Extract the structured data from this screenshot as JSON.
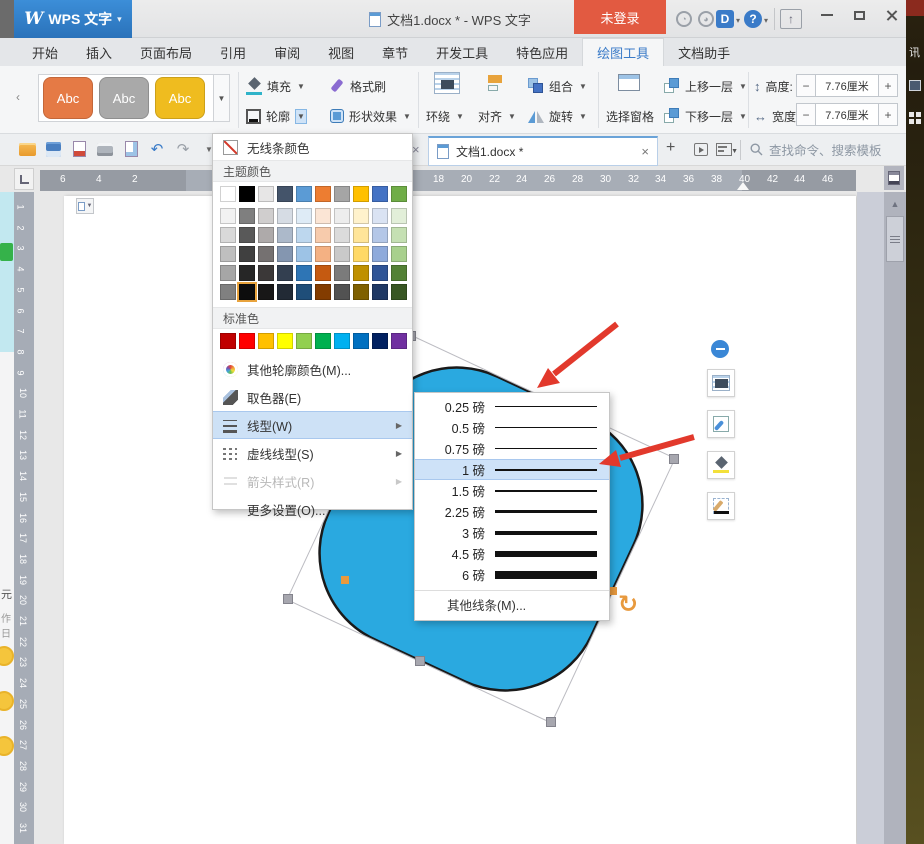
{
  "glyphs": {
    "dropdown": "▼",
    "submenu_arrow": "▶",
    "close": "×",
    "plus": "+",
    "minus": "−",
    "undo": "↶",
    "redo": "↷",
    "rotate": "↻",
    "scroll_up": "▲",
    "collapse_left": "‹",
    "app_dropdown": "▾",
    "gallery_more": "▼"
  },
  "title_bar": {
    "logo_letter": "W",
    "app_name": "WPS 文字",
    "doc_title": "文档1.docx * - WPS 文字",
    "login": "未登录",
    "d_badge": "D",
    "help": "?",
    "skin_arrow": "↑",
    "circle1": "◔",
    "circle2": "◕"
  },
  "ribbon_tabs": {
    "items": [
      "开始",
      "插入",
      "页面布局",
      "引用",
      "审阅",
      "视图",
      "章节",
      "开发工具",
      "特色应用",
      "绘图工具",
      "文档助手"
    ],
    "active_index": 9
  },
  "ribbon": {
    "style_samples": [
      "Abc",
      "Abc",
      "Abc"
    ],
    "style_colors": [
      "#E57A45",
      "#A9A9A9",
      "#EFBC1F"
    ],
    "fill": "填充",
    "format_painter": "格式刷",
    "outline": "轮廓",
    "shape_effects": "形状效果",
    "wrap": "环绕",
    "align": "对齐",
    "group": "组合",
    "rotate": "旋转",
    "selection_pane": "选择窗格",
    "bring_forward": "上移一层",
    "send_backward": "下移一层",
    "height_label": "高度:",
    "height_value": "7.76厘米",
    "width_label": "宽度:",
    "width_value": "7.76厘米",
    "height_glyph": "↕",
    "width_glyph": "↔"
  },
  "doc_bar": {
    "active_tab": "文档1.docx *",
    "search_placeholder": "查找命令、搜索模板"
  },
  "outline_menu": {
    "no_line": "无线条颜色",
    "theme_header": "主题颜色",
    "standard_header": "标准色",
    "theme_colors": [
      "#FFFFFF",
      "#000000",
      "#E7E6E6",
      "#44546A",
      "#5B9BD5",
      "#ED7D31",
      "#A5A5A5",
      "#FFC000",
      "#4472C4",
      "#70AD47"
    ],
    "variant_rows": [
      [
        "#F2F2F2",
        "#7F7F7F",
        "#D0CECE",
        "#D6DCE4",
        "#DEEBF6",
        "#FBE5D5",
        "#EDEDED",
        "#FFF2CC",
        "#DAE3F3",
        "#E2EFD9"
      ],
      [
        "#D9D9D9",
        "#595959",
        "#AEAAAA",
        "#ACB9CA",
        "#BDD7EE",
        "#F7CBAC",
        "#DBDBDB",
        "#FFE599",
        "#B4C7E7",
        "#C5E0B3"
      ],
      [
        "#BFBFBF",
        "#404040",
        "#757171",
        "#8496B0",
        "#9DC3E6",
        "#F4B183",
        "#C9C9C9",
        "#FFD966",
        "#8EAADB",
        "#A8D08D"
      ],
      [
        "#A6A6A6",
        "#262626",
        "#3B3838",
        "#333F50",
        "#2E75B5",
        "#C55A11",
        "#7B7B7B",
        "#BF9000",
        "#2F5496",
        "#538135"
      ],
      [
        "#808080",
        "#0D0D0D",
        "#181717",
        "#222A35",
        "#1F4E79",
        "#833C00",
        "#525252",
        "#7F6000",
        "#1F3864",
        "#385623"
      ]
    ],
    "selected_variant": {
      "row": 4,
      "col": 1
    },
    "standard_colors": [
      "#C00000",
      "#FF0000",
      "#FFC000",
      "#FFFF00",
      "#92D050",
      "#00B050",
      "#00B0F0",
      "#0070C0",
      "#002060",
      "#7030A0"
    ],
    "items": [
      {
        "label": "其他轮廓颜色(M)...",
        "icon": "color-wheel",
        "submenu": false,
        "disabled": false,
        "selected": false
      },
      {
        "label": "取色器(E)",
        "icon": "eyedropper",
        "submenu": false,
        "disabled": false,
        "selected": false
      },
      {
        "label": "线型(W)",
        "icon": "line-weights",
        "submenu": true,
        "disabled": false,
        "selected": true
      },
      {
        "label": "虚线线型(S)",
        "icon": "dash-styles",
        "submenu": true,
        "disabled": false,
        "selected": false
      },
      {
        "label": "箭头样式(R)",
        "icon": "arrow-styles",
        "submenu": true,
        "disabled": true,
        "selected": false
      },
      {
        "label": "更多设置(O)...",
        "icon": "none",
        "submenu": false,
        "disabled": false,
        "selected": false
      }
    ]
  },
  "line_weight_menu": {
    "items": [
      {
        "label": "0.25 磅",
        "pt": 0.25,
        "selected": false
      },
      {
        "label": "0.5 磅",
        "pt": 0.5,
        "selected": false
      },
      {
        "label": "0.75 磅",
        "pt": 0.75,
        "selected": false
      },
      {
        "label": "1 磅",
        "pt": 1,
        "selected": true
      },
      {
        "label": "1.5 磅",
        "pt": 1.5,
        "selected": false
      },
      {
        "label": "2.25 磅",
        "pt": 2.25,
        "selected": false
      },
      {
        "label": "3 磅",
        "pt": 3,
        "selected": false
      },
      {
        "label": "4.5 磅",
        "pt": 4.5,
        "selected": false
      },
      {
        "label": "6 磅",
        "pt": 6,
        "selected": false
      }
    ],
    "more": "其他线条(M)..."
  },
  "ruler": {
    "left_numbers": [
      "6",
      "4",
      "2"
    ],
    "right_numbers": [
      "18",
      "20",
      "22",
      "24",
      "26",
      "28",
      "30",
      "32",
      "34",
      "36",
      "38",
      "40",
      "42",
      "44",
      "46"
    ],
    "vertical_numbers": [
      "1",
      "2",
      "3",
      "4",
      "5",
      "6",
      "7",
      "8",
      "9",
      "10",
      "11",
      "12",
      "13",
      "14",
      "15",
      "16",
      "17",
      "18",
      "19",
      "20",
      "21",
      "22",
      "23",
      "24",
      "25",
      "26",
      "27",
      "28",
      "29",
      "30",
      "31"
    ]
  },
  "canvas": {
    "shape_fill": "#2AA9E0",
    "shape_outline": "#1a1a1a",
    "selection_color": "#bcbcc2",
    "handle_fill": "#a7a7af",
    "handle_stroke": "#83838c",
    "adjust_handle_color": "#E89A3E",
    "arrow_color": "#E2392C"
  },
  "desktop": {
    "right_text": "讯",
    "left_text_1": "元",
    "left_text_2": "作日"
  },
  "colors": {
    "accent_blue": "#3A7BC8",
    "login_orange": "#E25A41",
    "menu_highlight": "#CDE1F6",
    "selected_swatch_border": "#E8A33D"
  }
}
